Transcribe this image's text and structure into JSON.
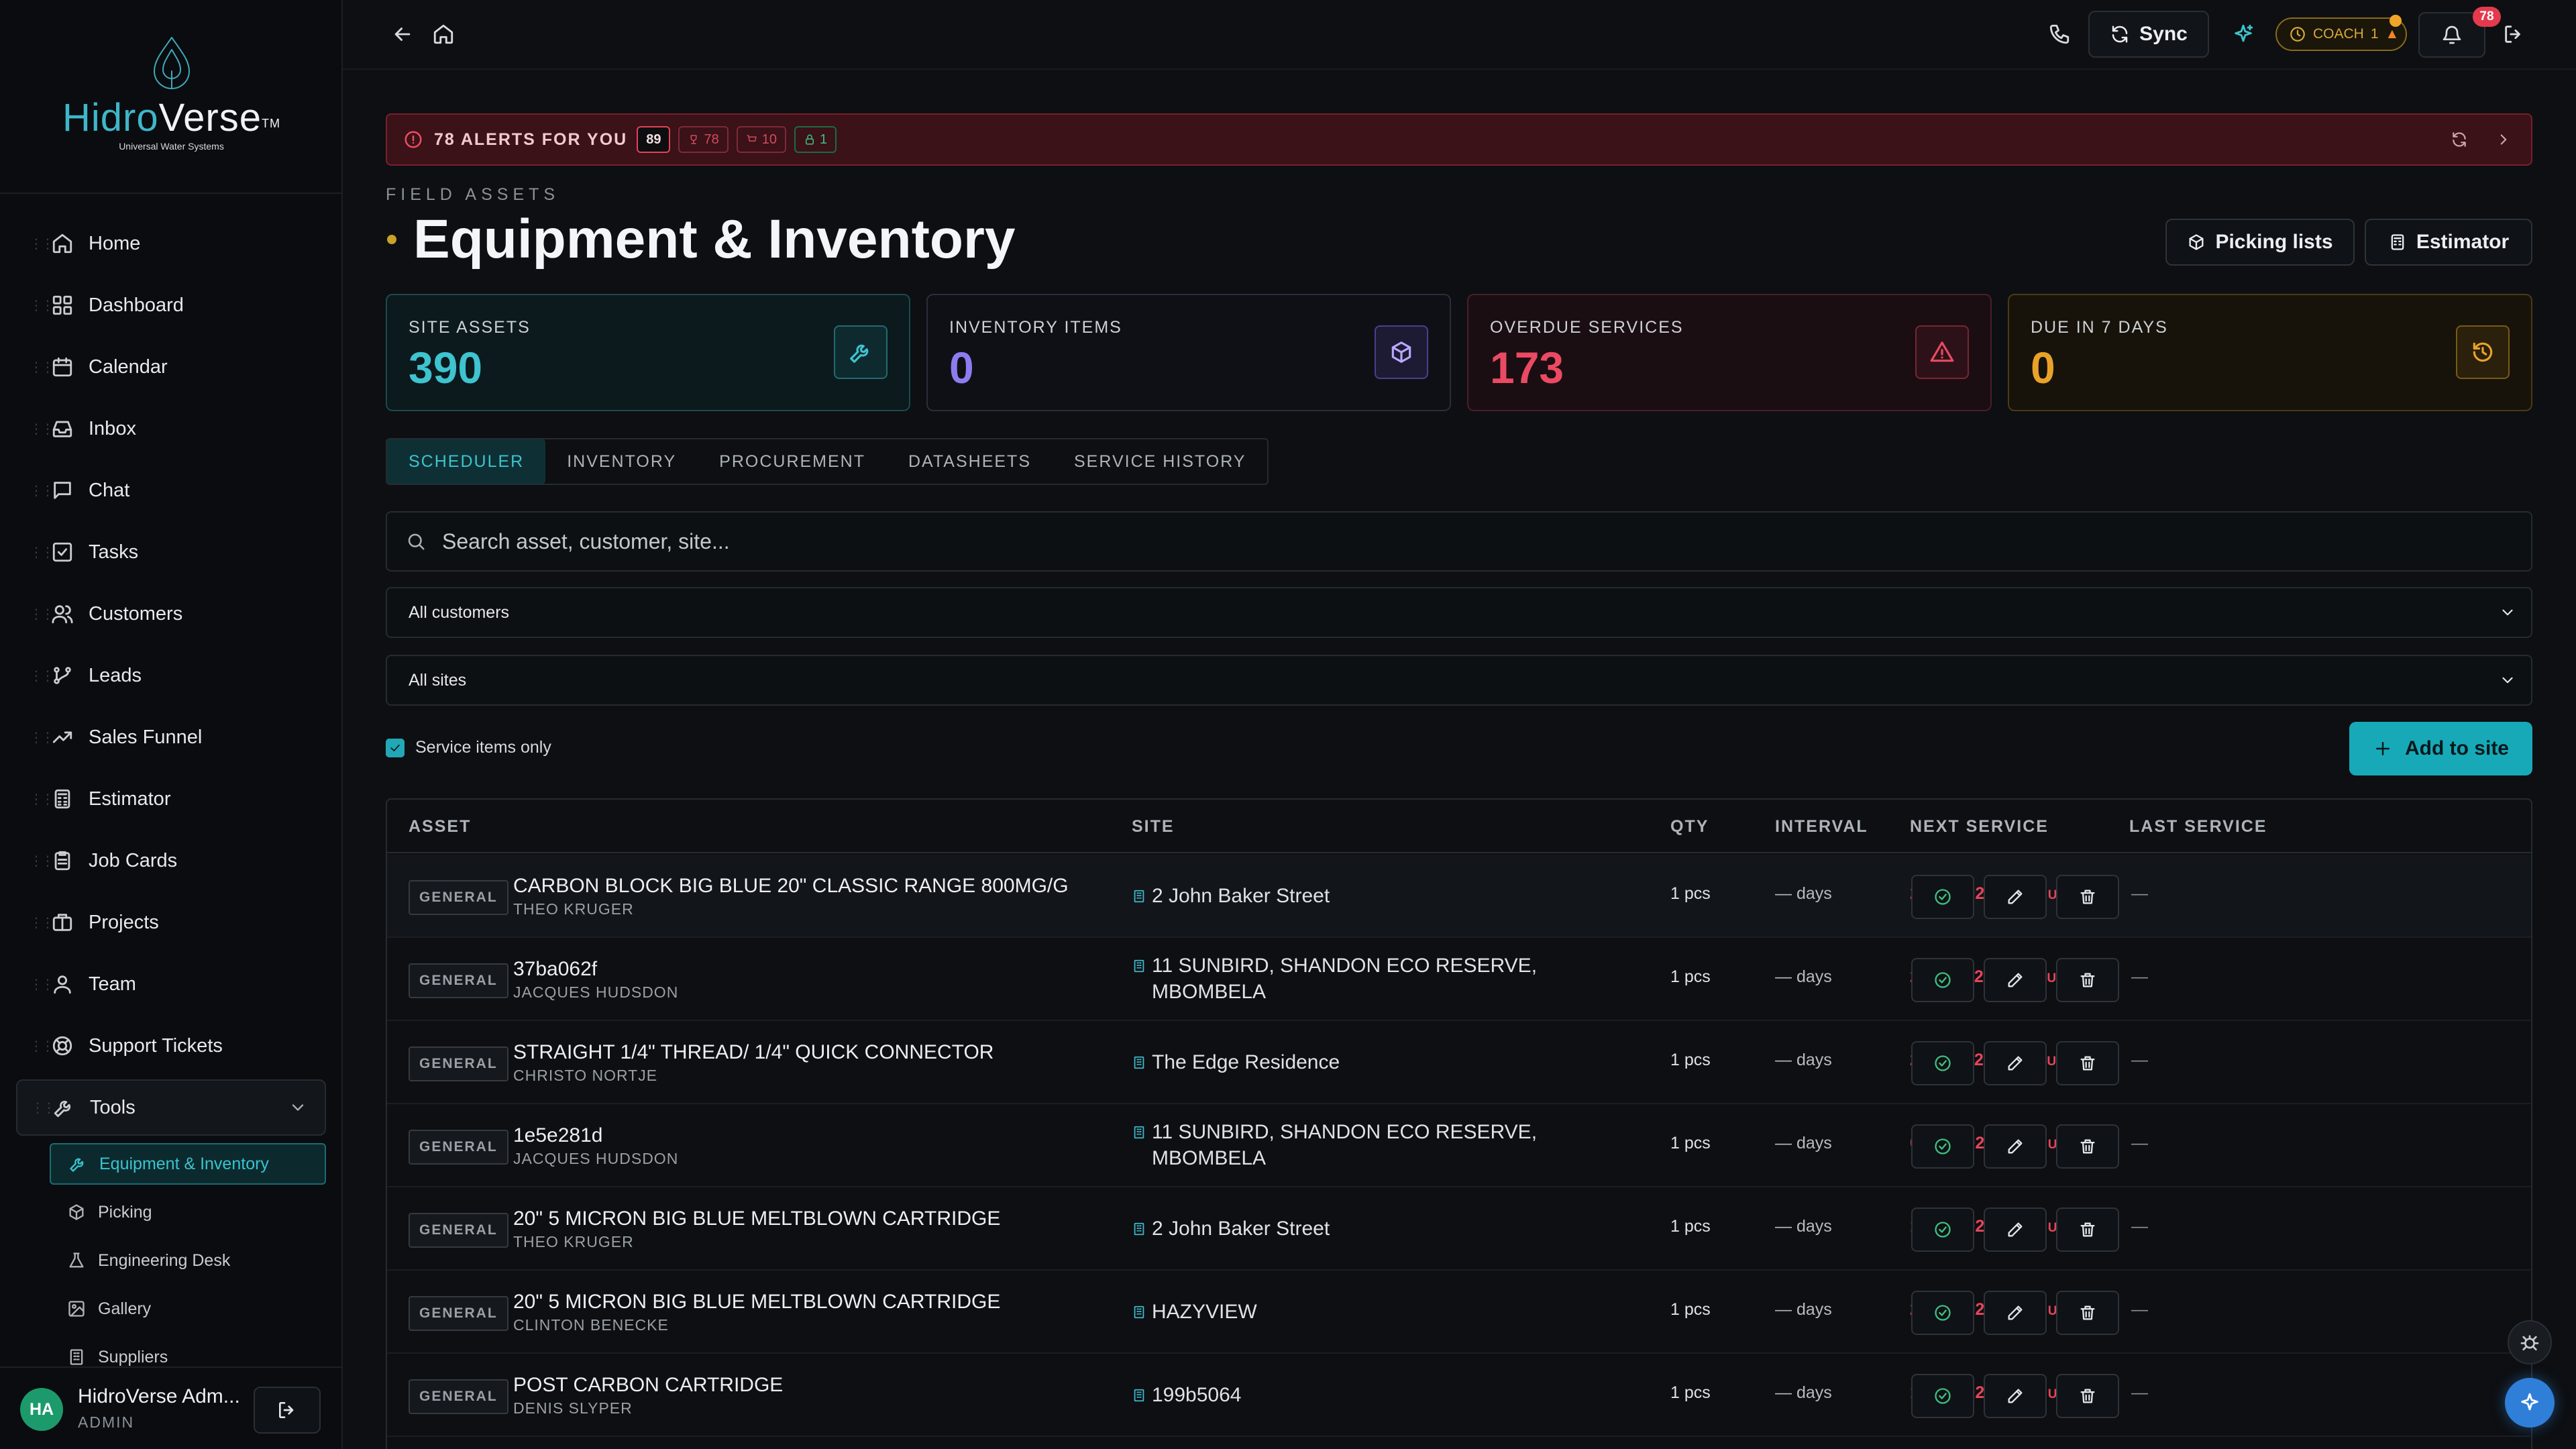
{
  "brand": {
    "name_part1": "Hidro",
    "name_part2": "Verse",
    "trademark": "TM",
    "tagline": "Universal Water Systems"
  },
  "sidebar": {
    "items": [
      {
        "label": "Home",
        "icon": "home-icon"
      },
      {
        "label": "Dashboard",
        "icon": "dashboard-icon"
      },
      {
        "label": "Calendar",
        "icon": "calendar-icon"
      },
      {
        "label": "Inbox",
        "icon": "inbox-icon"
      },
      {
        "label": "Chat",
        "icon": "chat-icon"
      },
      {
        "label": "Tasks",
        "icon": "tasks-icon"
      },
      {
        "label": "Customers",
        "icon": "customers-icon"
      },
      {
        "label": "Leads",
        "icon": "leads-icon"
      },
      {
        "label": "Sales Funnel",
        "icon": "trend-icon"
      },
      {
        "label": "Estimator",
        "icon": "calculator-icon"
      },
      {
        "label": "Job Cards",
        "icon": "clipboard-icon"
      },
      {
        "label": "Projects",
        "icon": "briefcase-icon"
      },
      {
        "label": "Team",
        "icon": "team-icon"
      },
      {
        "label": "Support Tickets",
        "icon": "lifebuoy-icon"
      },
      {
        "label": "Tools",
        "icon": "wrench-icon"
      }
    ],
    "tools_subitems": [
      {
        "label": "Equipment & Inventory",
        "icon": "wrench-icon",
        "active": true
      },
      {
        "label": "Picking",
        "icon": "package-icon"
      },
      {
        "label": "Engineering Desk",
        "icon": "flask-icon"
      },
      {
        "label": "Gallery",
        "icon": "image-icon"
      },
      {
        "label": "Suppliers",
        "icon": "building-icon"
      }
    ]
  },
  "user": {
    "initials": "HA",
    "name": "HidroVerse Adm...",
    "role": "ADMIN"
  },
  "topbar": {
    "sync_label": "Sync",
    "coach_label": "COACH",
    "coach_count": "1",
    "notification_count": "78"
  },
  "alerts": {
    "text": "78 ALERTS FOR YOU",
    "total": "89",
    "badge_a": "78",
    "badge_b": "10",
    "badge_c": "1"
  },
  "page": {
    "eyebrow": "FIELD ASSETS",
    "title": "Equipment & Inventory",
    "picking_lists_label": "Picking lists",
    "estimator_label": "Estimator"
  },
  "stats": [
    {
      "label": "SITE ASSETS",
      "value": "390",
      "color": "#3ec3cf"
    },
    {
      "label": "INVENTORY ITEMS",
      "value": "0",
      "color": "#8f7bf0"
    },
    {
      "label": "OVERDUE SERVICES",
      "value": "173",
      "color": "#ea4a62"
    },
    {
      "label": "DUE IN 7 DAYS",
      "value": "0",
      "color": "#e9a229"
    }
  ],
  "tabs": [
    "SCHEDULER",
    "INVENTORY",
    "PROCUREMENT",
    "DATASHEETS",
    "SERVICE HISTORY"
  ],
  "filters": {
    "search_placeholder": "Search asset, customer, site...",
    "customer_select": "All customers",
    "site_select": "All sites",
    "service_only_label": "Service items only",
    "service_only_checked": true,
    "add_label": "Add to site"
  },
  "table": {
    "headers": [
      "ASSET",
      "SITE",
      "QTY",
      "INTERVAL",
      "NEXT SERVICE",
      "LAST SERVICE"
    ],
    "rows": [
      {
        "category": "GENERAL",
        "asset": "CARBON BLOCK BIG BLUE 20\" CLASSIC RANGE 800MG/G",
        "customer": "THEO KRUGER",
        "site": "2 John Baker Street",
        "qty": "1 pcs",
        "interval": "— days",
        "next": "20/08/2021",
        "status": "OVERDUE",
        "last": "—"
      },
      {
        "category": "GENERAL",
        "asset": "37ba062f",
        "customer": "JACQUES HUDSDON",
        "site": "11 SUNBIRD, SHANDON ECO RESERVE, MBOMBELA",
        "qty": "1 pcs",
        "interval": "— days",
        "next": "24/11/2021",
        "status": "OVERDUE",
        "last": "—"
      },
      {
        "category": "GENERAL",
        "asset": "STRAIGHT 1/4\" THREAD/ 1/4\" QUICK CONNECTOR",
        "customer": "CHRISTO NORTJE",
        "site": "The Edge Residence",
        "qty": "1 pcs",
        "interval": "— days",
        "next": "24/11/2021",
        "status": "OVERDUE",
        "last": "—"
      },
      {
        "category": "GENERAL",
        "asset": "1e5e281d",
        "customer": "JACQUES HUDSDON",
        "site": "11 SUNBIRD, SHANDON ECO RESERVE, MBOMBELA",
        "qty": "1 pcs",
        "interval": "— days",
        "next": "05/01/2022",
        "status": "OVERDUE",
        "last": "—"
      },
      {
        "category": "GENERAL",
        "asset": "20\" 5 MICRON BIG BLUE MELTBLOWN CARTRIDGE",
        "customer": "THEO KRUGER",
        "site": "2 John Baker Street",
        "qty": "1 pcs",
        "interval": "— days",
        "next": "18/02/2022",
        "status": "OVERDUE",
        "last": "—"
      },
      {
        "category": "GENERAL",
        "asset": "20\" 5 MICRON BIG BLUE MELTBLOWN CARTRIDGE",
        "customer": "CLINTON BENECKE",
        "site": "HAZYVIEW",
        "qty": "1 pcs",
        "interval": "— days",
        "next": "29/04/2022",
        "status": "OVERDUE",
        "last": "—"
      },
      {
        "category": "GENERAL",
        "asset": "POST CARBON CARTRIDGE",
        "customer": "DENIS SLYPER",
        "site": "199b5064",
        "qty": "1 pcs",
        "interval": "— days",
        "next": "15/06/2022",
        "status": "OVERDUE",
        "last": "—"
      }
    ]
  }
}
